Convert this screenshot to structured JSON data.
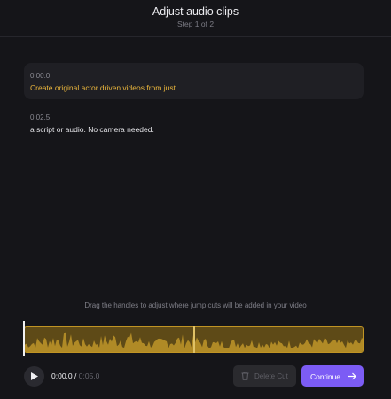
{
  "header": {
    "title": "Adjust audio clips",
    "step": "Step 1 of 2"
  },
  "clips": [
    {
      "timestamp": "0:00.0",
      "text": "Create original actor driven videos from just",
      "active": true
    },
    {
      "timestamp": "0:02.5",
      "text": "a script or audio. No camera needed.",
      "active": false
    }
  ],
  "editor": {
    "hint": "Drag the handles to adjust where jump cuts will be added in your video",
    "current_time": "0:00.0",
    "separator": "/",
    "duration": "0:05.0",
    "split_at_seconds": 2.5
  },
  "actions": {
    "delete_label": "Delete Cut",
    "continue_label": "Continue"
  },
  "colors": {
    "background": "#151519",
    "accent": "#7c5cf5",
    "highlight": "#e9b53c",
    "waveform": "#b08a26"
  },
  "icons": {
    "play": "play-icon",
    "trash": "trash-icon",
    "arrow": "arrow-right-icon"
  }
}
